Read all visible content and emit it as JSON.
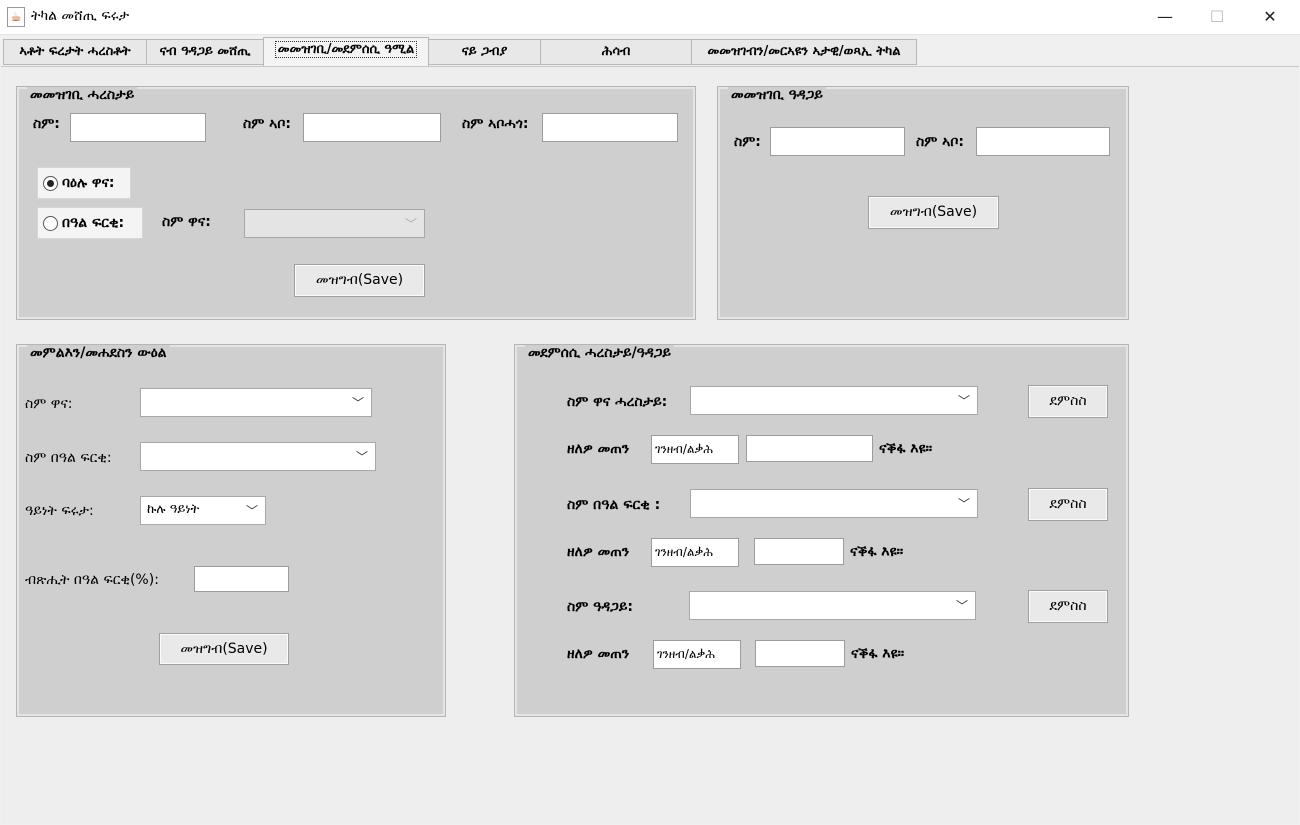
{
  "window": {
    "title": "ትካል መሸጢ ፍሩታ",
    "icon": "java-cup-icon",
    "controls": {
      "minimize": "—",
      "maximize": "☐",
      "close": "✕"
    }
  },
  "tabs": [
    {
      "label": "ኣቶት ፍረታት ሓረስቶት"
    },
    {
      "label": "ናብ ዓዳጋይ መሸጢ"
    },
    {
      "label": "መመዝገቢ/መደምሰሲ ዓሚል",
      "active": true
    },
    {
      "label": "ናይ ጋብያ"
    },
    {
      "label": "ሕሳብ"
    },
    {
      "label": "መመዝገብን/መርኣዩን ኣታዊ/ወጻኢ ትካል"
    }
  ],
  "farmer_reg": {
    "title": "መመዝገቢ ሓረስታይ",
    "name_label": "ስም:",
    "father_label": "ስም ኣቦ:",
    "grandfather_label": "ስም ኣቦሓጎ:",
    "radio_owner": "ባዕሉ ዋና:",
    "radio_partner": "በዓል ፍርቂ:",
    "owner_name_label": "ስም ዋና:",
    "save": "መዝግብ(Save)"
  },
  "buyer_reg": {
    "title": "መመዝገቢ ዓዳጋይ",
    "name_label": "ስም:",
    "father_label": "ስም ኣቦ:",
    "save": "መዝግብ(Save)"
  },
  "contract": {
    "title": "መምልእን/መሐደስን ውዕል",
    "owner_label": "ስም ዋና:",
    "partner_label": "ስም በዓል ፍርቂ:",
    "type_label": "ዓይነት ፍሩታ:",
    "type_value": "ኩሉ ዓይነት",
    "percent_label": "ብጽሒት በዓል ፍርቂ(%):",
    "save": "መዝግብ(Save)"
  },
  "delete": {
    "title": "መደምሰሲ ሓረስታይ/ዓዳጋይ",
    "farmer_label": "ስም ዋና ሓረስታይ:",
    "partner_label": "ስም በዓል ፍርቂ :",
    "buyer_label": "ስም ዓዳጋይ:",
    "button": "ደምስስ",
    "balance_label": "ዘለዎ መጠን",
    "money_tag": "ገንዘብ/ልቃሕ",
    "unit": "ናቕፋ እዩ።"
  }
}
